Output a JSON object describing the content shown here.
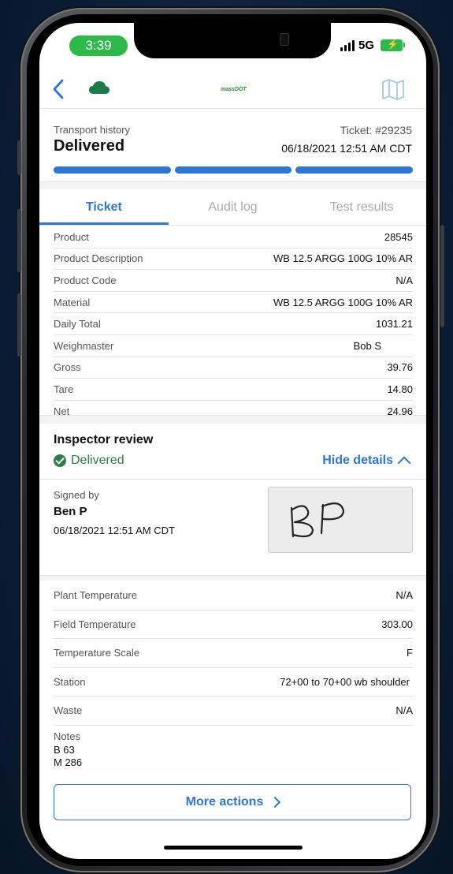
{
  "status_bar": {
    "time": "3:39",
    "network": "5G"
  },
  "nav": {
    "logo_text": "massDOT",
    "icons": [
      "back-chevron-icon",
      "cloud-icon",
      "map-icon"
    ]
  },
  "header": {
    "label": "Transport history",
    "status": "Delivered",
    "ticket": "Ticket: #29235",
    "datetime": "06/18/2021 12:51 AM CDT"
  },
  "tabs": [
    {
      "label": "Ticket",
      "active": true
    },
    {
      "label": "Audit log",
      "active": false
    },
    {
      "label": "Test results",
      "active": false
    }
  ],
  "ticket_rows": [
    {
      "key": "Product",
      "value": "28545"
    },
    {
      "key": "Product Description",
      "value": "WB 12.5 ARGG 100G 10% AR"
    },
    {
      "key": "Product Code",
      "value": "N/A"
    },
    {
      "key": "Material",
      "value": "WB 12.5 ARGG 100G 10% AR"
    },
    {
      "key": "Daily Total",
      "value": "1031.21"
    },
    {
      "key": "Weighmaster",
      "value": "Bob S"
    },
    {
      "key": "Gross",
      "value": "39.76"
    },
    {
      "key": "Tare",
      "value": "14.80"
    },
    {
      "key": "Net",
      "value": "24.96"
    }
  ],
  "inspector": {
    "title": "Inspector review",
    "status": "Delivered",
    "toggle_label": "Hide details",
    "signed_label": "Signed by",
    "signed_name": "Ben P",
    "signed_date": "06/18/2021 12:51 AM CDT",
    "signature": "BP"
  },
  "detail_rows": [
    {
      "key": "Plant Temperature",
      "value": "N/A"
    },
    {
      "key": "Field Temperature",
      "value": "303.00"
    },
    {
      "key": "Temperature Scale",
      "value": "F"
    },
    {
      "key": "Station",
      "value": "72+00 to 70+00 wb shoulder"
    },
    {
      "key": "Waste",
      "value": "N/A"
    }
  ],
  "notes": {
    "label": "Notes",
    "lines": [
      "B 63",
      "M 286"
    ]
  },
  "more_actions": "More actions",
  "colors": {
    "accent": "#2f77d0",
    "success": "#2e7d4f",
    "status_green": "#30b94b"
  }
}
